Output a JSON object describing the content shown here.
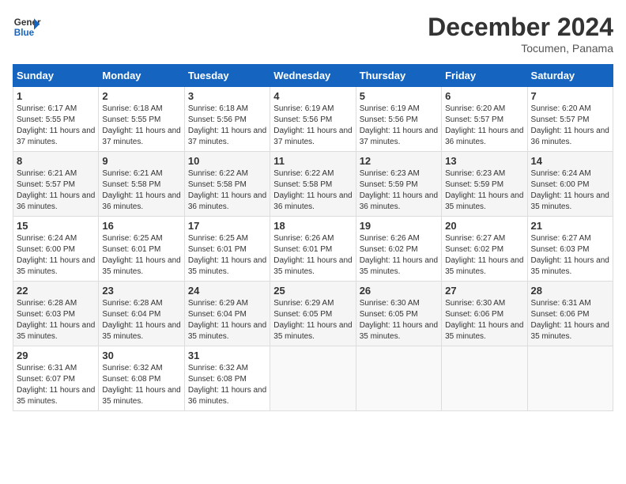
{
  "header": {
    "logo_line1": "General",
    "logo_line2": "Blue",
    "month": "December 2024",
    "location": "Tocumen, Panama"
  },
  "days_of_week": [
    "Sunday",
    "Monday",
    "Tuesday",
    "Wednesday",
    "Thursday",
    "Friday",
    "Saturday"
  ],
  "weeks": [
    [
      {
        "day": "1",
        "sunrise": "6:17 AM",
        "sunset": "5:55 PM",
        "daylight": "11 hours and 37 minutes."
      },
      {
        "day": "2",
        "sunrise": "6:18 AM",
        "sunset": "5:55 PM",
        "daylight": "11 hours and 37 minutes."
      },
      {
        "day": "3",
        "sunrise": "6:18 AM",
        "sunset": "5:56 PM",
        "daylight": "11 hours and 37 minutes."
      },
      {
        "day": "4",
        "sunrise": "6:19 AM",
        "sunset": "5:56 PM",
        "daylight": "11 hours and 37 minutes."
      },
      {
        "day": "5",
        "sunrise": "6:19 AM",
        "sunset": "5:56 PM",
        "daylight": "11 hours and 37 minutes."
      },
      {
        "day": "6",
        "sunrise": "6:20 AM",
        "sunset": "5:57 PM",
        "daylight": "11 hours and 36 minutes."
      },
      {
        "day": "7",
        "sunrise": "6:20 AM",
        "sunset": "5:57 PM",
        "daylight": "11 hours and 36 minutes."
      }
    ],
    [
      {
        "day": "8",
        "sunrise": "6:21 AM",
        "sunset": "5:57 PM",
        "daylight": "11 hours and 36 minutes."
      },
      {
        "day": "9",
        "sunrise": "6:21 AM",
        "sunset": "5:58 PM",
        "daylight": "11 hours and 36 minutes."
      },
      {
        "day": "10",
        "sunrise": "6:22 AM",
        "sunset": "5:58 PM",
        "daylight": "11 hours and 36 minutes."
      },
      {
        "day": "11",
        "sunrise": "6:22 AM",
        "sunset": "5:58 PM",
        "daylight": "11 hours and 36 minutes."
      },
      {
        "day": "12",
        "sunrise": "6:23 AM",
        "sunset": "5:59 PM",
        "daylight": "11 hours and 36 minutes."
      },
      {
        "day": "13",
        "sunrise": "6:23 AM",
        "sunset": "5:59 PM",
        "daylight": "11 hours and 35 minutes."
      },
      {
        "day": "14",
        "sunrise": "6:24 AM",
        "sunset": "6:00 PM",
        "daylight": "11 hours and 35 minutes."
      }
    ],
    [
      {
        "day": "15",
        "sunrise": "6:24 AM",
        "sunset": "6:00 PM",
        "daylight": "11 hours and 35 minutes."
      },
      {
        "day": "16",
        "sunrise": "6:25 AM",
        "sunset": "6:01 PM",
        "daylight": "11 hours and 35 minutes."
      },
      {
        "day": "17",
        "sunrise": "6:25 AM",
        "sunset": "6:01 PM",
        "daylight": "11 hours and 35 minutes."
      },
      {
        "day": "18",
        "sunrise": "6:26 AM",
        "sunset": "6:01 PM",
        "daylight": "11 hours and 35 minutes."
      },
      {
        "day": "19",
        "sunrise": "6:26 AM",
        "sunset": "6:02 PM",
        "daylight": "11 hours and 35 minutes."
      },
      {
        "day": "20",
        "sunrise": "6:27 AM",
        "sunset": "6:02 PM",
        "daylight": "11 hours and 35 minutes."
      },
      {
        "day": "21",
        "sunrise": "6:27 AM",
        "sunset": "6:03 PM",
        "daylight": "11 hours and 35 minutes."
      }
    ],
    [
      {
        "day": "22",
        "sunrise": "6:28 AM",
        "sunset": "6:03 PM",
        "daylight": "11 hours and 35 minutes."
      },
      {
        "day": "23",
        "sunrise": "6:28 AM",
        "sunset": "6:04 PM",
        "daylight": "11 hours and 35 minutes."
      },
      {
        "day": "24",
        "sunrise": "6:29 AM",
        "sunset": "6:04 PM",
        "daylight": "11 hours and 35 minutes."
      },
      {
        "day": "25",
        "sunrise": "6:29 AM",
        "sunset": "6:05 PM",
        "daylight": "11 hours and 35 minutes."
      },
      {
        "day": "26",
        "sunrise": "6:30 AM",
        "sunset": "6:05 PM",
        "daylight": "11 hours and 35 minutes."
      },
      {
        "day": "27",
        "sunrise": "6:30 AM",
        "sunset": "6:06 PM",
        "daylight": "11 hours and 35 minutes."
      },
      {
        "day": "28",
        "sunrise": "6:31 AM",
        "sunset": "6:06 PM",
        "daylight": "11 hours and 35 minutes."
      }
    ],
    [
      {
        "day": "29",
        "sunrise": "6:31 AM",
        "sunset": "6:07 PM",
        "daylight": "11 hours and 35 minutes."
      },
      {
        "day": "30",
        "sunrise": "6:32 AM",
        "sunset": "6:08 PM",
        "daylight": "11 hours and 35 minutes."
      },
      {
        "day": "31",
        "sunrise": "6:32 AM",
        "sunset": "6:08 PM",
        "daylight": "11 hours and 36 minutes."
      },
      null,
      null,
      null,
      null
    ]
  ]
}
